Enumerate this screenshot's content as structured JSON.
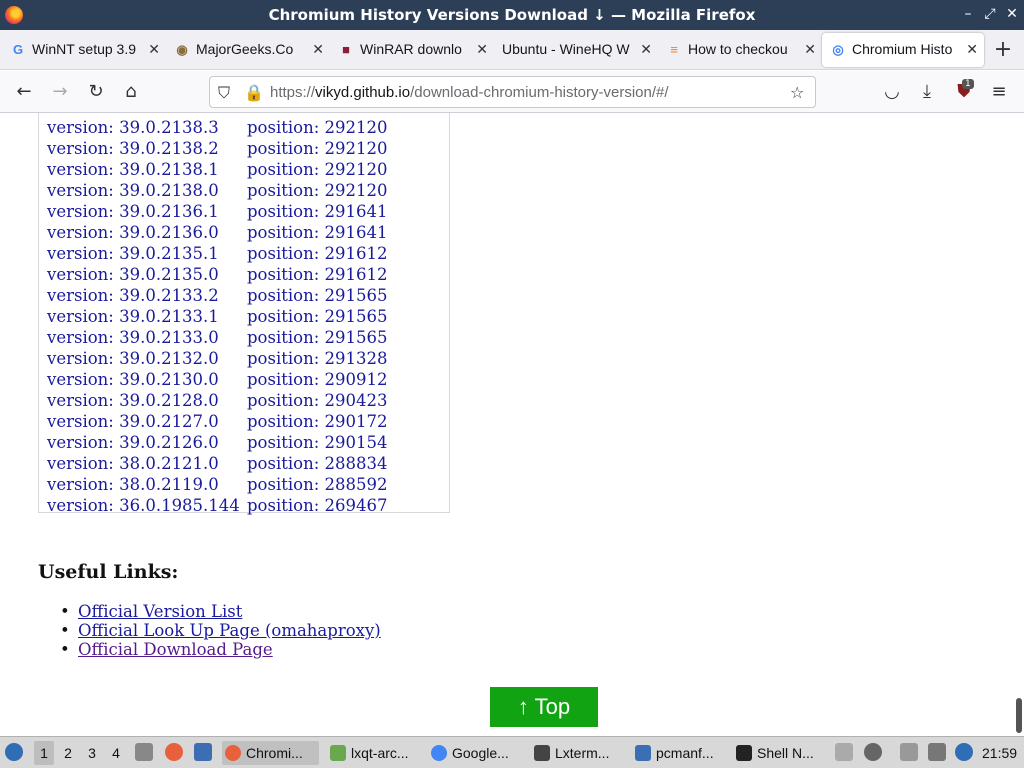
{
  "window": {
    "title": "Chromium History Versions Download ↓ — Mozilla Firefox",
    "controls": [
      "–",
      "⤢",
      "✕"
    ]
  },
  "tabs": [
    {
      "label": "WinNT setup 3.9",
      "icon": "google-icon",
      "icon_glyph": "G",
      "icon_color": "#4285f4"
    },
    {
      "label": "MajorGeeks.Co",
      "icon": "majorgeeks-icon",
      "icon_glyph": "◉",
      "icon_color": "#8a6d3b"
    },
    {
      "label": "WinRAR downlo",
      "icon": "winrar-icon",
      "icon_glyph": "■",
      "icon_color": "#8b1c3a"
    },
    {
      "label": "Ubuntu - WineHQ W",
      "icon": "",
      "icon_glyph": "",
      "icon_color": "#333"
    },
    {
      "label": "How to checkou",
      "icon": "stackoverflow-icon",
      "icon_glyph": "≡",
      "icon_color": "#f48024"
    },
    {
      "label": "Chromium Histo",
      "icon": "chromium-icon",
      "icon_glyph": "◎",
      "icon_color": "#4285f4",
      "active": true
    }
  ],
  "url": {
    "prefix": "https://",
    "domain": "vikyd.github.io",
    "path": "/download-chromium-history-version/#/"
  },
  "addon_badge": "1",
  "versions": [
    {
      "version": "version: 39.0.2138.3",
      "position": "position: 292120"
    },
    {
      "version": "version: 39.0.2138.2",
      "position": "position: 292120"
    },
    {
      "version": "version: 39.0.2138.1",
      "position": "position: 292120"
    },
    {
      "version": "version: 39.0.2138.0",
      "position": "position: 292120"
    },
    {
      "version": "version: 39.0.2136.1",
      "position": "position: 291641"
    },
    {
      "version": "version: 39.0.2136.0",
      "position": "position: 291641"
    },
    {
      "version": "version: 39.0.2135.1",
      "position": "position: 291612"
    },
    {
      "version": "version: 39.0.2135.0",
      "position": "position: 291612"
    },
    {
      "version": "version: 39.0.2133.2",
      "position": "position: 291565"
    },
    {
      "version": "version: 39.0.2133.1",
      "position": "position: 291565"
    },
    {
      "version": "version: 39.0.2133.0",
      "position": "position: 291565"
    },
    {
      "version": "version: 39.0.2132.0",
      "position": "position: 291328"
    },
    {
      "version": "version: 39.0.2130.0",
      "position": "position: 290912"
    },
    {
      "version": "version: 39.0.2128.0",
      "position": "position: 290423"
    },
    {
      "version": "version: 39.0.2127.0",
      "position": "position: 290172"
    },
    {
      "version": "version: 39.0.2126.0",
      "position": "position: 290154"
    },
    {
      "version": "version: 38.0.2121.0",
      "position": "position: 288834"
    },
    {
      "version": "version: 38.0.2119.0",
      "position": "position: 288592"
    },
    {
      "version": "version: 36.0.1985.144",
      "position": "position: 269467"
    }
  ],
  "useful_links": {
    "title": "Useful Links:",
    "links": [
      "Official Version List",
      "Official Look Up Page (omahaproxy)",
      "Official Download Page"
    ]
  },
  "top_button": "↑ Top",
  "taskbar": {
    "desktops": [
      "1",
      "2",
      "3",
      "4"
    ],
    "active_desktop": "1",
    "tasks": [
      {
        "label": "Chromi...",
        "icon": "firefox-icon",
        "color": "#e8603c",
        "active": true
      },
      {
        "label": "lxqt-arc...",
        "icon": "archiver-icon",
        "color": "#6aa84f"
      },
      {
        "label": "Google...",
        "icon": "chrome-icon",
        "color": "#4285f4"
      },
      {
        "label": "Lxterm...",
        "icon": "terminal-icon",
        "color": "#444"
      },
      {
        "label": "pcmanf...",
        "icon": "folder-icon",
        "color": "#3c6eb4"
      },
      {
        "label": "Shell N...",
        "icon": "shell-icon",
        "color": "#222"
      }
    ],
    "clock": "21:59"
  }
}
